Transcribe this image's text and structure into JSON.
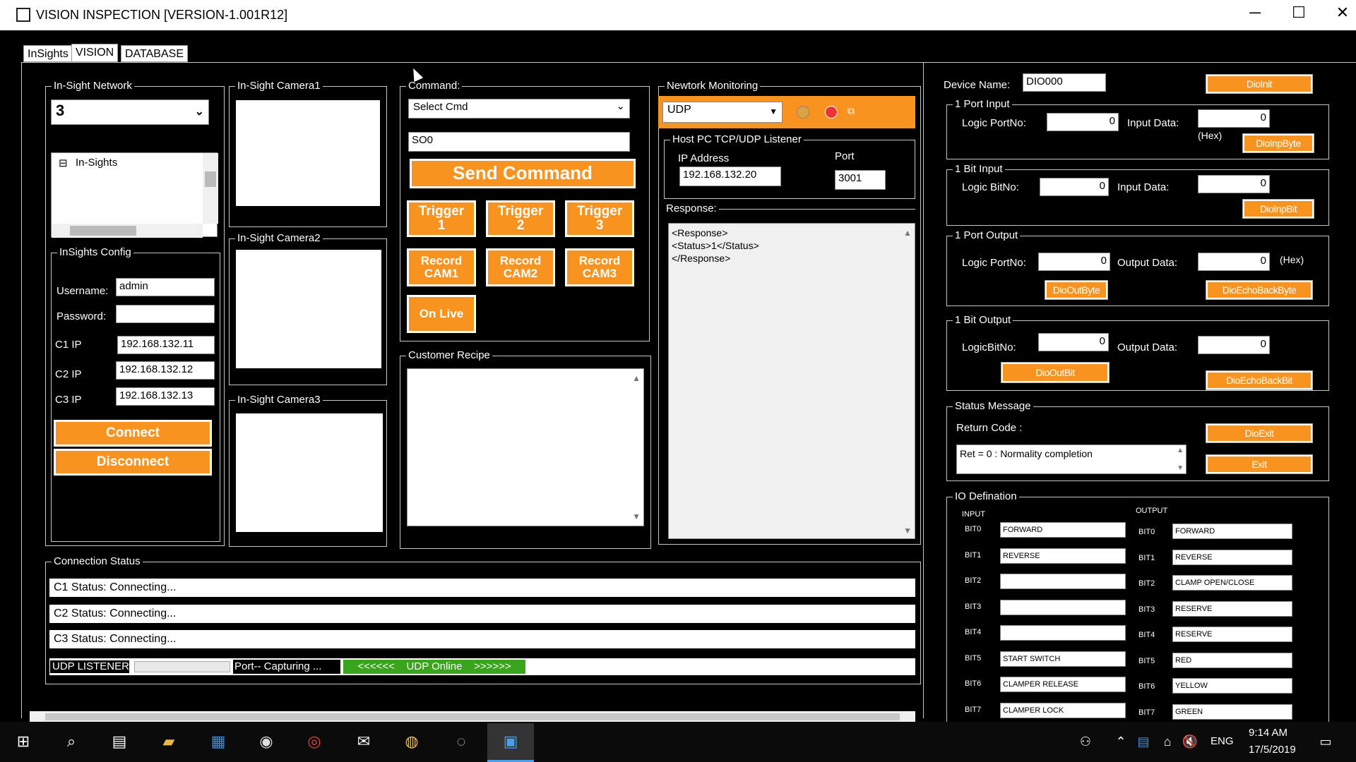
{
  "window": {
    "title": "VISION INSPECTION [VERSION-1.001R12]",
    "minimize": "─",
    "maximize": "☐",
    "close": "✕"
  },
  "tabs": [
    "InSights",
    "VISION",
    "DATABASE"
  ],
  "insight_network": {
    "legend": "In-Sight Network",
    "selected": "3",
    "tree_item": "In-Sights"
  },
  "insights_config": {
    "legend": "InSights Config",
    "username_label": "Username:",
    "username": "admin",
    "password_label": "Password:",
    "password": "",
    "c1_label": "C1 IP",
    "c1": "192.168.132.11",
    "c2_label": "C2 IP",
    "c2": "192.168.132.12",
    "c3_label": "C3 IP",
    "c3": "192.168.132.13",
    "connect": "Connect",
    "disconnect": "Disconnect"
  },
  "cameras": [
    "In-Sight Camera1",
    "In-Sight Camera2",
    "In-Sight Camera3"
  ],
  "command": {
    "legend": "Command:",
    "select": "Select Cmd",
    "value": "SO0",
    "send": "Send Command",
    "trigger1": "Trigger\n1",
    "trigger2": "Trigger\n2",
    "trigger3": "Trigger\n3",
    "rec1": "Record\nCAM1",
    "rec2": "Record\nCAM2",
    "rec3": "Record\nCAM3",
    "live": "On Live"
  },
  "recipe": {
    "legend": "Customer Recipe"
  },
  "network": {
    "legend": "Newtork Monitoring",
    "protocol": "UDP",
    "listener": "Host PC TCP/UDP Listener",
    "ip_label": "IP Address",
    "ip": "192.168.132.20",
    "port_label": "Port",
    "port": "3001",
    "response_label": "Response:",
    "response": "<Response>\n<Status>1</Status>\n</Response>"
  },
  "device": {
    "name_label": "Device Name:",
    "name": "DIO000",
    "init": "DioInit",
    "port_input": {
      "legend": "1 Port Input",
      "label": "Logic PortNo:",
      "value": "0",
      "data_label": "Input Data:",
      "data": "0",
      "hex": "(Hex)",
      "btn": "DioInpByte"
    },
    "bit_input": {
      "legend": "1 Bit Input",
      "label": "Logic BitNo:",
      "value": "0",
      "data_label": "Input Data:",
      "data": "0",
      "btn": "DioInpBit"
    },
    "port_output": {
      "legend": "1 Port Output",
      "label": "Logic PortNo:",
      "value": "0",
      "data_label": "Output Data:",
      "data": "0",
      "hex": "(Hex)",
      "btn1": "DioOutByte",
      "btn2": "DioEchoBackByte"
    },
    "bit_output": {
      "legend": "1 Bit Output",
      "label": "LogicBitNo:",
      "value": "0",
      "data_label": "Output Data:",
      "data": "0",
      "btn1": "DioOutBit",
      "btn2": "DioEchoBackBit"
    },
    "status": {
      "legend": "Status Message",
      "rc_label": "Return Code :",
      "message": "Ret = 0 : Normality completion",
      "exit1": "DioExit",
      "exit2": "Exit"
    }
  },
  "io": {
    "legend": "IO Defination",
    "input_hdr": "INPUT",
    "output_hdr": "OUTPUT",
    "bits": [
      "BIT0",
      "BIT1",
      "BIT2",
      "BIT3",
      "BIT4",
      "BIT5",
      "BIT6",
      "BIT7"
    ],
    "inputs": [
      "FORWARD",
      "REVERSE",
      "",
      "",
      "",
      "START SWITCH",
      "CLAMPER RELEASE",
      "CLAMPER LOCK"
    ],
    "outputs": [
      "FORWARD",
      "REVERSE",
      "CLAMP OPEN/CLOSE",
      "RESERVE",
      "RESERVE",
      "RED",
      "YELLOW",
      "GREEN"
    ]
  },
  "connection": {
    "legend": "Connection Status",
    "c1": "C1 Status:  Connecting...",
    "c2": "C2 Status:  Connecting...",
    "c3": "C3 Status:  Connecting...",
    "udp_label": "UDP LISTENER",
    "port_txt": "Port--   Capturing ...",
    "udp_online": "<<<<<<    UDP Online    >>>>>>"
  },
  "taskbar": {
    "lang": "ENG",
    "time": "9:14 AM",
    "date": "17/5/2019"
  }
}
